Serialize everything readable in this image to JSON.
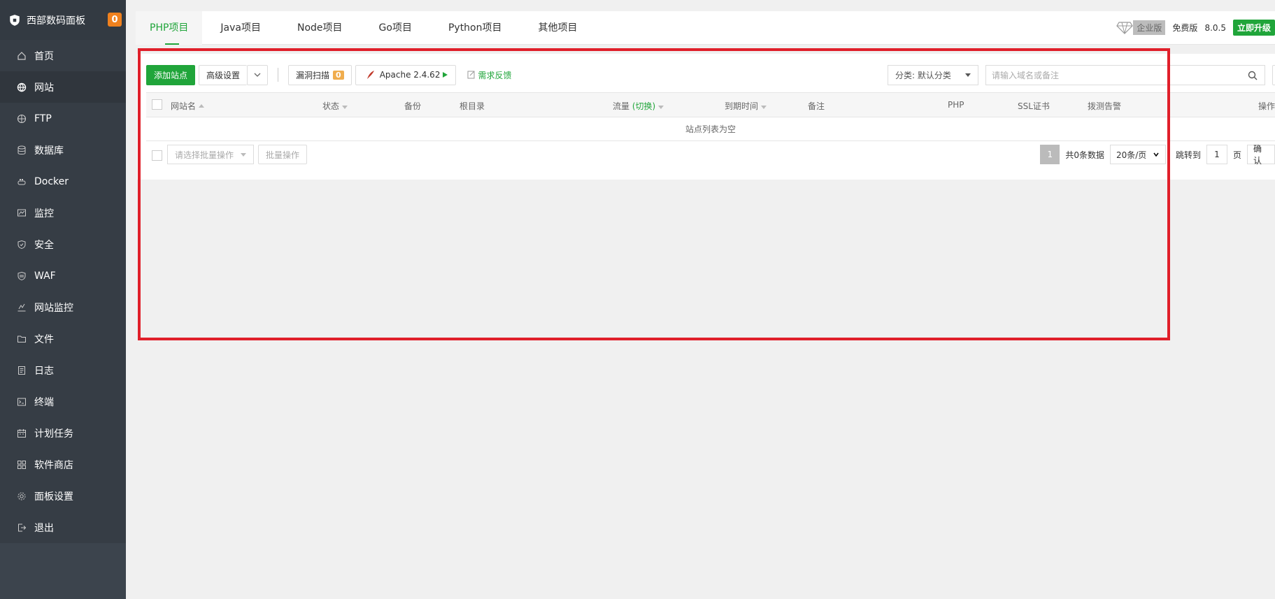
{
  "brand": {
    "title": "西部数码面板",
    "badge": "0"
  },
  "sidebar": {
    "items": [
      {
        "label": "首页",
        "icon": "home-icon"
      },
      {
        "label": "网站",
        "icon": "globe-icon"
      },
      {
        "label": "FTP",
        "icon": "ftp-icon"
      },
      {
        "label": "数据库",
        "icon": "database-icon"
      },
      {
        "label": "Docker",
        "icon": "docker-icon"
      },
      {
        "label": "监控",
        "icon": "monitor-icon"
      },
      {
        "label": "安全",
        "icon": "shield-icon"
      },
      {
        "label": "WAF",
        "icon": "waf-icon"
      },
      {
        "label": "网站监控",
        "icon": "site-monitor-icon"
      },
      {
        "label": "文件",
        "icon": "folder-icon"
      },
      {
        "label": "日志",
        "icon": "log-icon"
      },
      {
        "label": "终端",
        "icon": "terminal-icon"
      },
      {
        "label": "计划任务",
        "icon": "calendar-icon"
      },
      {
        "label": "软件商店",
        "icon": "apps-icon"
      },
      {
        "label": "面板设置",
        "icon": "gear-icon"
      },
      {
        "label": "退出",
        "icon": "logout-icon"
      }
    ],
    "active_index": 1
  },
  "tabs": [
    "PHP项目",
    "Java项目",
    "Node项目",
    "Go项目",
    "Python项目",
    "其他项目"
  ],
  "top_right": {
    "enterprise": "企业版",
    "free": "免费版",
    "version": "8.0.5",
    "upgrade": "立即升级"
  },
  "toolbar": {
    "add_site": "添加站点",
    "advanced": "高级设置",
    "vuln_scan": "漏洞扫描",
    "vuln_count": "0",
    "apache": "Apache 2.4.62",
    "feedback": "需求反馈",
    "category": "分类: 默认分类",
    "search_placeholder": "请输入域名或备注"
  },
  "table": {
    "columns": [
      "网站名",
      "状态",
      "备份",
      "根目录",
      "流量",
      "(切换)",
      "到期时间",
      "备注",
      "PHP",
      "SSL证书",
      "拨测告警",
      "操作"
    ],
    "empty_text": "站点列表为空"
  },
  "footer": {
    "batch_select": "请选择批量操作",
    "batch_btn": "批量操作",
    "page": "1",
    "total": "共0条数据",
    "per_page": "20条/页",
    "jump_label": "跳转到",
    "jump_value": "1",
    "page_unit": "页",
    "confirm": "确认"
  },
  "colors": {
    "accent": "#20a53a",
    "highlight": "#e01f2a",
    "sidebar": "#3c444d",
    "badge": "#f0811e"
  }
}
